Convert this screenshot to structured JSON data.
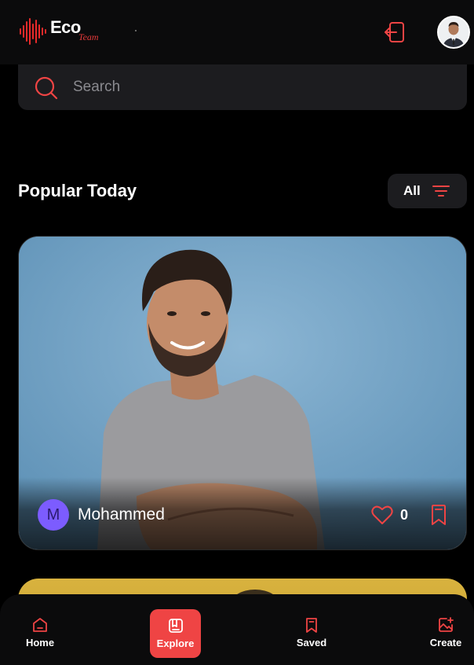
{
  "header": {
    "logo_word": "Eco",
    "logo_script": "Team",
    "logout_icon": "logout-icon",
    "avatar_icon": "user-avatar"
  },
  "search": {
    "placeholder": "Search",
    "icon": "search-icon"
  },
  "section": {
    "title": "Popular Today",
    "filter_label": "All",
    "filter_icon": "filter-lines-icon"
  },
  "post": {
    "author_initial": "M",
    "author_name": "Mohammed",
    "likes": "0",
    "like_icon": "heart-icon",
    "save_icon": "bookmark-icon"
  },
  "nav": {
    "items": [
      {
        "label": "Home",
        "icon": "home-icon"
      },
      {
        "label": "Explore",
        "icon": "explore-icon",
        "active": true
      },
      {
        "label": "Saved",
        "icon": "bookmark-icon"
      },
      {
        "label": "Create",
        "icon": "image-add-icon"
      }
    ]
  },
  "colors": {
    "accent": "#ef4444",
    "background": "#000000",
    "surface": "#1c1c1f",
    "author_avatar": "#7c5cff"
  }
}
